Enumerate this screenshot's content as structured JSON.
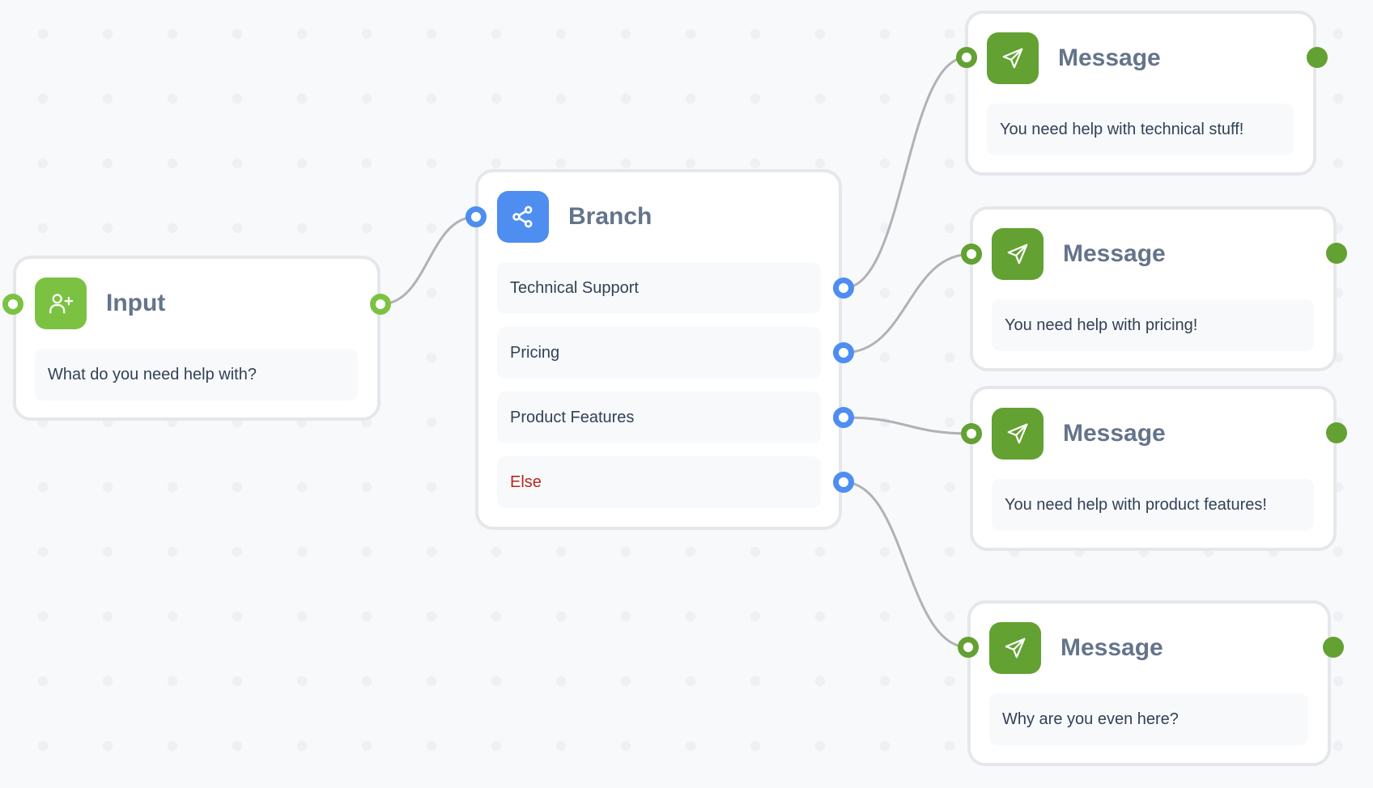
{
  "colors": {
    "input_accent": "#7cc242",
    "branch_accent": "#4d8ef0",
    "message_accent": "#63a132",
    "else_text": "#b02a1e",
    "edge": "#b1b1b7"
  },
  "nodes": {
    "input": {
      "title": "Input",
      "icon": "user-plus-icon",
      "prompt": "What do you need help with?"
    },
    "branch": {
      "title": "Branch",
      "icon": "share-icon",
      "options": [
        {
          "label": "Technical Support"
        },
        {
          "label": "Pricing"
        },
        {
          "label": "Product Features"
        },
        {
          "label": "Else"
        }
      ]
    },
    "messages": [
      {
        "title": "Message",
        "icon": "send-icon",
        "text": "You need help with technical stuff!"
      },
      {
        "title": "Message",
        "icon": "send-icon",
        "text": "You need help with pricing!"
      },
      {
        "title": "Message",
        "icon": "send-icon",
        "text": "You need help with product features!"
      },
      {
        "title": "Message",
        "icon": "send-icon",
        "text": "Why are you even here?"
      }
    ]
  },
  "edges": [
    {
      "from": "input",
      "to": "branch"
    },
    {
      "from": "branch.Technical Support",
      "to": "messages.0"
    },
    {
      "from": "branch.Pricing",
      "to": "messages.1"
    },
    {
      "from": "branch.Product Features",
      "to": "messages.2"
    },
    {
      "from": "branch.Else",
      "to": "messages.3"
    }
  ]
}
